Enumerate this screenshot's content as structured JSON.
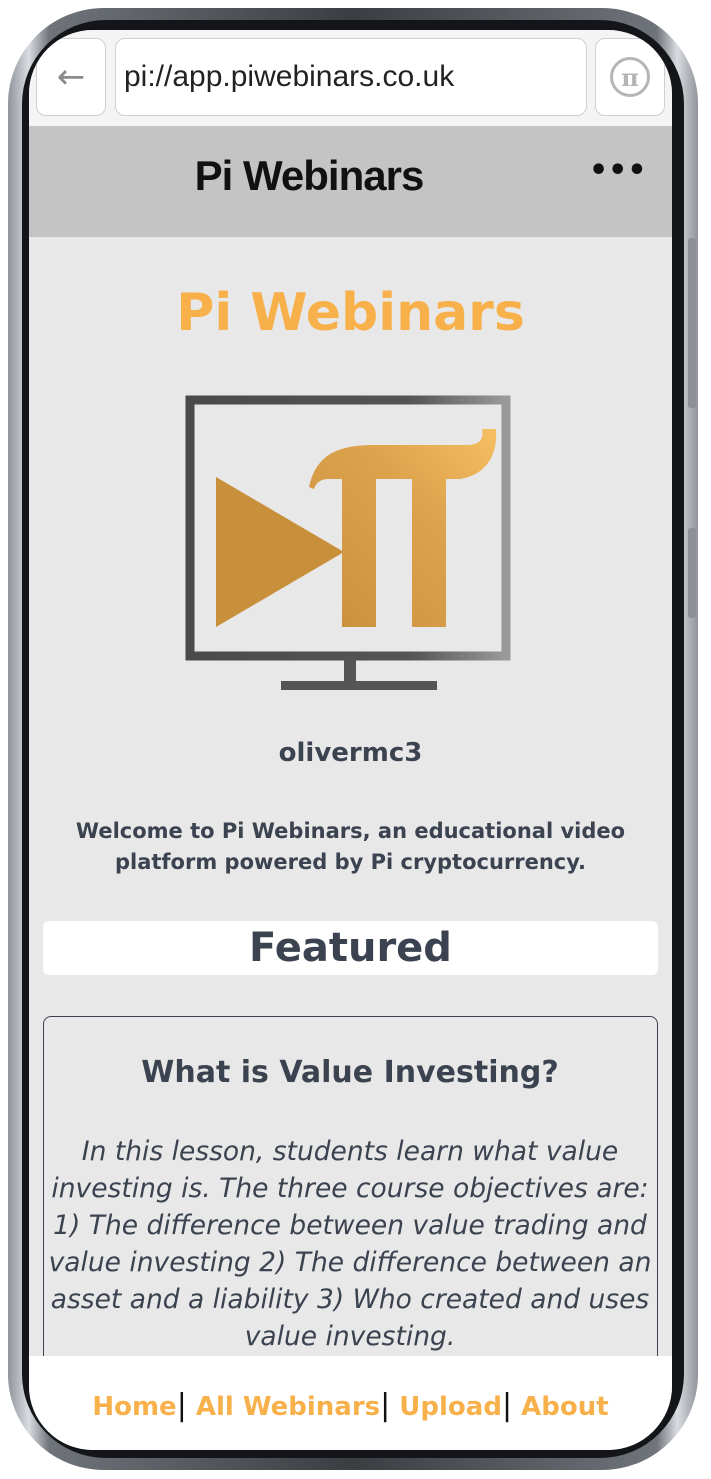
{
  "browser": {
    "back_icon": "←",
    "url": "pi://app.piwebinars.co.uk",
    "pi_icon": "π"
  },
  "header": {
    "title": "Pi Webinars",
    "more_icon": "•••"
  },
  "main": {
    "brand_title": "Pi Webinars",
    "username": "olivermc3",
    "welcome": "Welcome to Pi Webinars, an educational video platform powered by Pi cryptocurrency.",
    "featured_heading": "Featured",
    "featured_card": {
      "title": "What is Value Investing?",
      "description": "In this lesson, students learn what value investing is. The three course objectives are: 1) The difference between value trading and value investing 2) The difference between an asset and a liability 3) Who created and uses value investing."
    }
  },
  "bottom_nav": {
    "items": [
      {
        "label": "Home"
      },
      {
        "label": "All Webinars"
      },
      {
        "label": "Upload"
      },
      {
        "label": "About"
      }
    ],
    "separator": "|"
  },
  "colors": {
    "accent": "#f7b04a",
    "text": "#3b4350",
    "header_bg": "#c4c4c4",
    "page_bg": "#e8e8e8"
  }
}
